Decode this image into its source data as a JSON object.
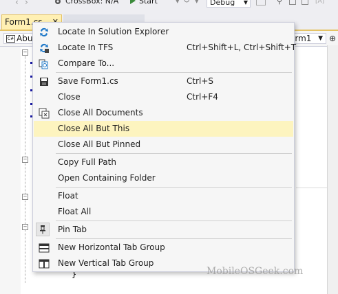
{
  "toolbar": {
    "platform_combo": "CrossBox: N/A",
    "start_label": "Start",
    "config_combo": "Debug"
  },
  "tabs": [
    {
      "label": "Form1.cs",
      "close": "✕"
    }
  ],
  "navbar": {
    "left_combo": "Abu",
    "right_combo": "orm1"
  },
  "editor": {
    "brace": "}"
  },
  "context_menu": {
    "items": [
      {
        "label": "Locate In Solution Explorer",
        "shortcut": "",
        "icon": "locate-solution-icon"
      },
      {
        "label": "Locate In TFS",
        "shortcut": "Ctrl+Shift+L, Ctrl+Shift+T",
        "icon": "locate-tfs-icon"
      },
      {
        "label": "Compare To...",
        "shortcut": "",
        "icon": "compare-icon"
      },
      {
        "label": "Save Form1.cs",
        "shortcut": "Ctrl+S",
        "icon": "save-icon"
      },
      {
        "label": "Close",
        "shortcut": "Ctrl+F4",
        "icon": ""
      },
      {
        "label": "Close All Documents",
        "shortcut": "",
        "icon": "close-all-documents-icon"
      },
      {
        "label": "Close All But This",
        "shortcut": "",
        "icon": ""
      },
      {
        "label": "Close All But Pinned",
        "shortcut": "",
        "icon": ""
      },
      {
        "label": "Copy Full Path",
        "shortcut": "",
        "icon": ""
      },
      {
        "label": "Open Containing Folder",
        "shortcut": "",
        "icon": ""
      },
      {
        "label": "Float",
        "shortcut": "",
        "icon": ""
      },
      {
        "label": "Float All",
        "shortcut": "",
        "icon": ""
      },
      {
        "label": "Pin Tab",
        "shortcut": "",
        "icon": "pin-icon"
      },
      {
        "label": "New Horizontal Tab Group",
        "shortcut": "",
        "icon": "horizontal-tab-group-icon"
      },
      {
        "label": "New Vertical Tab Group",
        "shortcut": "",
        "icon": "vertical-tab-group-icon"
      }
    ],
    "highlighted_item": "Close All But This"
  },
  "watermark": "MobileOSGeek.com",
  "colors": {
    "highlight": "#fdf4bf",
    "active_tab": "#fff0b3",
    "icon_blue": "#1e78c8"
  }
}
